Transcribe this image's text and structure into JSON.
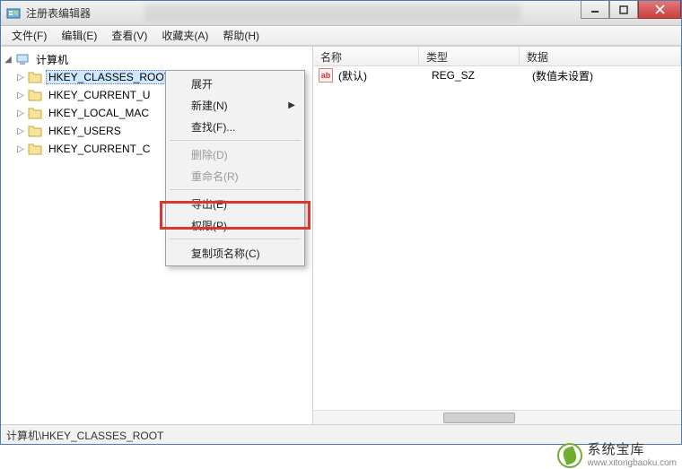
{
  "titlebar": {
    "title": "注册表编辑器"
  },
  "menubar": {
    "file": "文件(F)",
    "edit": "编辑(E)",
    "view": "查看(V)",
    "favorites": "收藏夹(A)",
    "help": "帮助(H)"
  },
  "tree": {
    "root": "计算机",
    "keys": [
      "HKEY_CLASSES_ROOT",
      "HKEY_CURRENT_U",
      "HKEY_LOCAL_MAC",
      "HKEY_USERS",
      "HKEY_CURRENT_C"
    ]
  },
  "list": {
    "headers": {
      "name": "名称",
      "type": "类型",
      "data": "数据"
    },
    "rows": [
      {
        "icon": "ab",
        "name": "(默认)",
        "type": "REG_SZ",
        "data": "(数值未设置)"
      }
    ]
  },
  "context_menu": {
    "expand": "展开",
    "new": "新建(N)",
    "find": "查找(F)...",
    "delete": "删除(D)",
    "rename": "重命名(R)",
    "export": "导出(E)",
    "permissions": "权限(P)...",
    "copy_key_name": "复制项名称(C)"
  },
  "statusbar": {
    "path": "计算机\\HKEY_CLASSES_ROOT"
  },
  "watermark": {
    "line1": "系统宝库",
    "line2": "www.xitongbaoku.com"
  }
}
